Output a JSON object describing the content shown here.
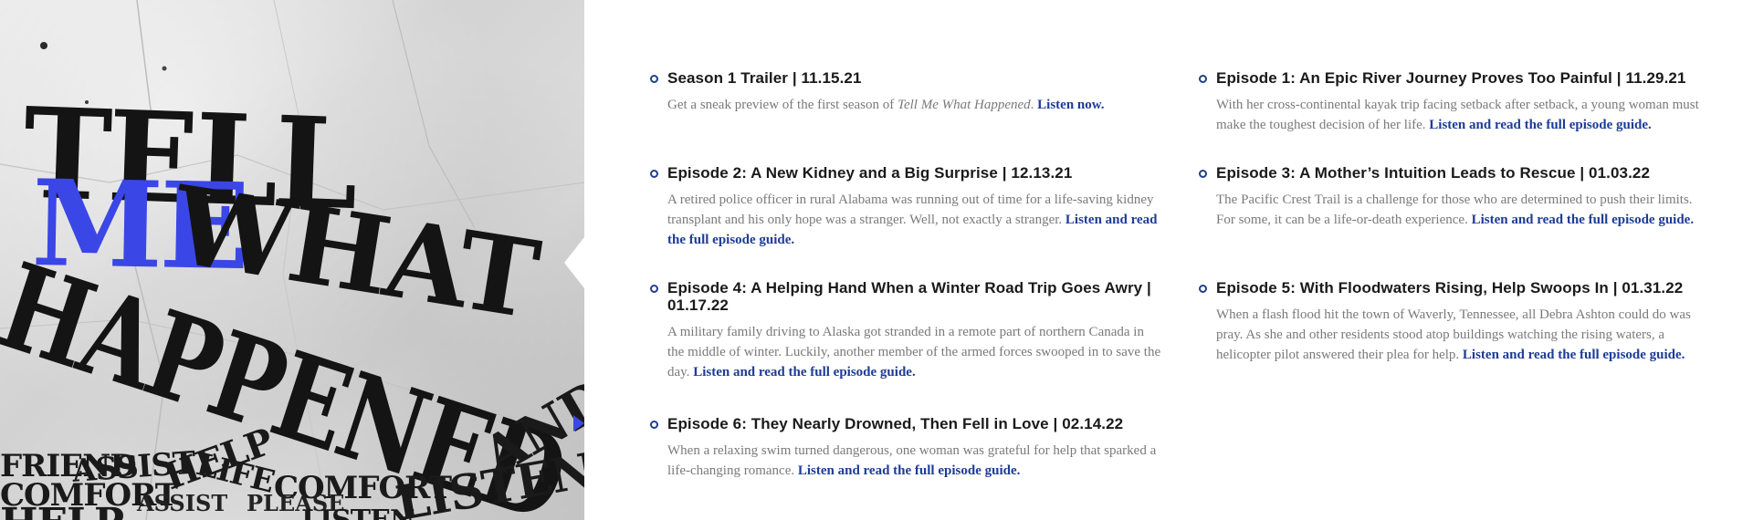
{
  "hero": {
    "title_words": [
      "TELL",
      "ME",
      "WHAT",
      "HAPPENED"
    ],
    "accent_color": "#3b46e6",
    "background_words": [
      "FRIEND",
      "ASSIST",
      "COMFORT",
      "COMFORT",
      "ASSIST",
      "PLEASE",
      "HELP",
      "LISTEN",
      "AND",
      "LIFE",
      "LISTEN",
      "HELP"
    ]
  },
  "episodes": [
    {
      "title": "Season 1 Trailer | 11.15.21",
      "desc_prefix": "Get a sneak preview of the first season of ",
      "desc_italic": "Tell Me What Happened",
      "desc_suffix": ". ",
      "link": "Listen now."
    },
    {
      "title": "Episode 1: An Epic River Journey Proves Too Painful | 11.29.21",
      "desc": "With her cross-continental kayak trip facing setback after setback, a young woman must make the toughest decision of her life. ",
      "link": "Listen and read the full episode guide."
    },
    {
      "title": "Episode 2: A New Kidney and a Big Surprise | 12.13.21",
      "desc": "A retired police officer in rural Alabama was running out of time for a life-saving kidney transplant and his only hope was a stranger. Well, not exactly a stranger. ",
      "link": "Listen and read the full episode guide."
    },
    {
      "title": "Episode 3: A Mother’s Intuition Leads to Rescue | 01.03.22",
      "desc": "The Pacific Crest Trail is a challenge for those who are determined to push their limits. For some, it can be a life-or-death experience. ",
      "link": "Listen and read the full episode guide."
    },
    {
      "title": "Episode 4: A Helping Hand When a Winter Road Trip Goes Awry | 01.17.22",
      "desc": "A military family driving to Alaska got stranded in a remote part of northern Canada in the middle of winter. Luckily, another member of the armed forces swooped in to save the day. ",
      "link": "Listen and read the full episode guide."
    },
    {
      "title": "Episode 5: With Floodwaters Rising, Help Swoops In | 01.31.22",
      "desc": "When a flash flood hit the town of Waverly, Tennessee, all Debra Ashton could do was pray. As she and other residents stood atop buildings watching the rising waters, a helicopter pilot answered their plea for help. ",
      "link": "Listen and read the full episode guide."
    },
    {
      "title": "Episode 6: They Nearly Drowned, Then Fell in Love | 02.14.22",
      "desc": "When a relaxing swim turned dangerous, one woman was grateful for help that sparked a life-changing romance. ",
      "link": "Listen and read the full episode guide."
    }
  ],
  "colors": {
    "title": "#1a1a1a",
    "description": "#7a7a7a",
    "link": "#1e3c96",
    "bullet": "#1f3f8a"
  }
}
